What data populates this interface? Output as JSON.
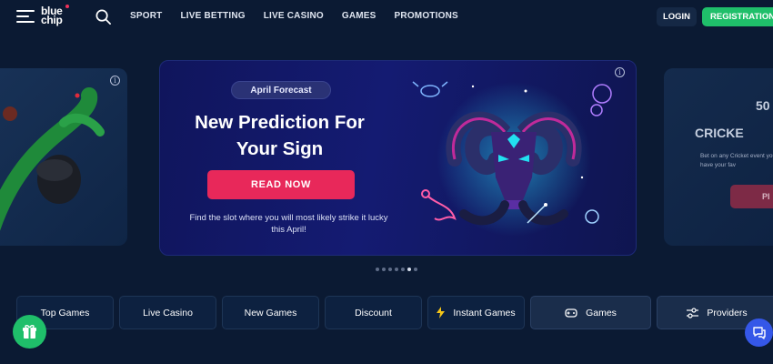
{
  "header": {
    "logo_line1": "blue",
    "logo_line2": "chip",
    "nav": [
      "SPORT",
      "LIVE BETTING",
      "LIVE CASINO",
      "GAMES",
      "PROMOTIONS"
    ],
    "login_label": "LOGIN",
    "registration_label": "REGISTRATION"
  },
  "banner": {
    "badge": "April Forecast",
    "headline": "New Prediction For Your Sign",
    "cta_label": "READ NOW",
    "subtext": "Find the slot where you will most likely strike it lucky this April!",
    "next_slide_text_1": "50",
    "next_slide_text_2": "CRICKE",
    "next_slide_small": "Bet on any Cricket event you have your fav",
    "next_slide_btn": "PI"
  },
  "carousel": {
    "dot_count": 7,
    "active_index": 5
  },
  "tabs": [
    {
      "label": "Top Games",
      "icon": ""
    },
    {
      "label": "Live Casino",
      "icon": ""
    },
    {
      "label": "New Games",
      "icon": ""
    },
    {
      "label": "Discount",
      "icon": ""
    },
    {
      "label": "Instant Games",
      "icon": "lightning-icon"
    },
    {
      "label": "Games",
      "icon": "gamepad-icon"
    },
    {
      "label": "Providers",
      "icon": "sliders-icon"
    }
  ],
  "colors": {
    "background": "#0b1a33",
    "accent_green": "#1fbf6a",
    "cta_pink": "#e8285a",
    "chat_blue": "#3557e8"
  }
}
